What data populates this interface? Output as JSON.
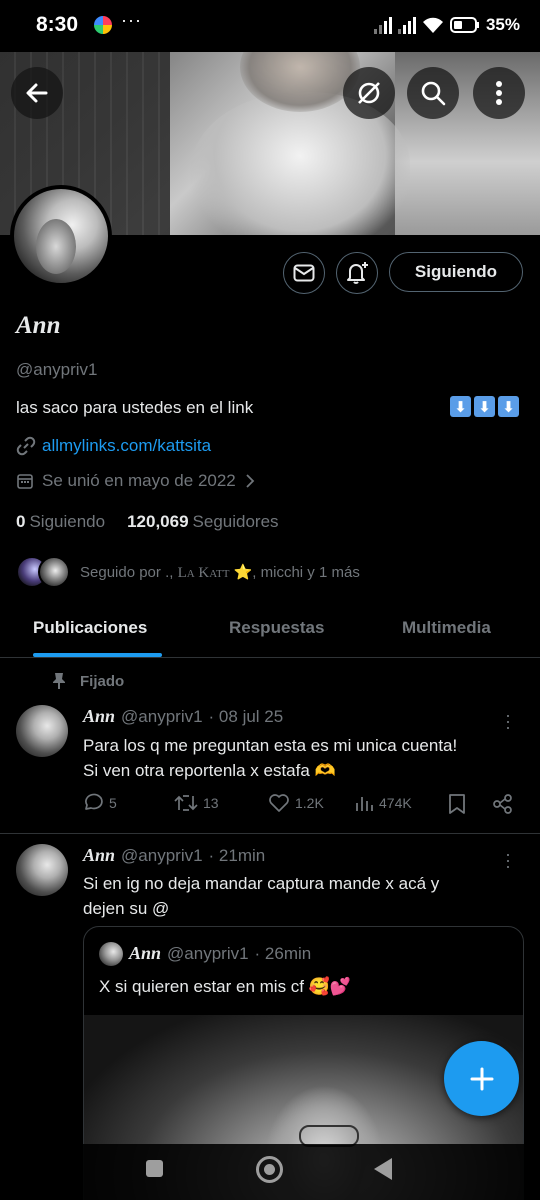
{
  "status_bar": {
    "time": "8:30",
    "dots": "···",
    "battery": "35%"
  },
  "header": {
    "back_icon": "arrow-left-icon",
    "grok_icon": "grok-icon",
    "search_icon": "search-icon",
    "more_icon": "more-vertical-icon"
  },
  "profile": {
    "name": "Ann",
    "handle": "@anypriv1",
    "bio": "las saco para ustedes en el link",
    "bio_emoji": [
      "⬇",
      "⬇",
      "⬇"
    ],
    "link": "allmylinks.com/kattsita",
    "joined": "Se unió en mayo de 2022",
    "following_count": "0",
    "following_label": "Siguiendo",
    "followers_count": "120,069",
    "followers_label": "Seguidores",
    "followed_by_prefix": "Seguido por .,",
    "followed_by_katt": "La Katt",
    "followed_by_suffix": ", micchi y 1 más",
    "follow_button": "Siguiendo"
  },
  "tabs": [
    {
      "label": "Publicaciones",
      "active": true
    },
    {
      "label": "Respuestas",
      "active": false
    },
    {
      "label": "Multimedia",
      "active": false
    }
  ],
  "pinned_label": "Fijado",
  "posts": [
    {
      "name": "Ann",
      "handle": "@anypriv1",
      "time": "· 08 jul 25",
      "text_line1": "Para los q me preguntan esta es mi unica cuenta!",
      "text_line2": "Si ven otra reportenla x estafa 🫶",
      "replies": "5",
      "reposts": "13",
      "likes": "1.2K",
      "views": "474K"
    },
    {
      "name": "Ann",
      "handle": "@anypriv1",
      "time": "· 21min",
      "text_line1": "Si en ig no deja mandar captura mande x acá y",
      "text_line2": "dejen su @",
      "quote": {
        "name": "Ann",
        "handle": "@anypriv1",
        "time": "· 26min",
        "text": "X si quieren estar en mis cf 🥰💕"
      }
    }
  ],
  "colors": {
    "accent": "#1d9bf0",
    "muted": "#71767b",
    "border": "#2f3336",
    "background": "#000000"
  }
}
